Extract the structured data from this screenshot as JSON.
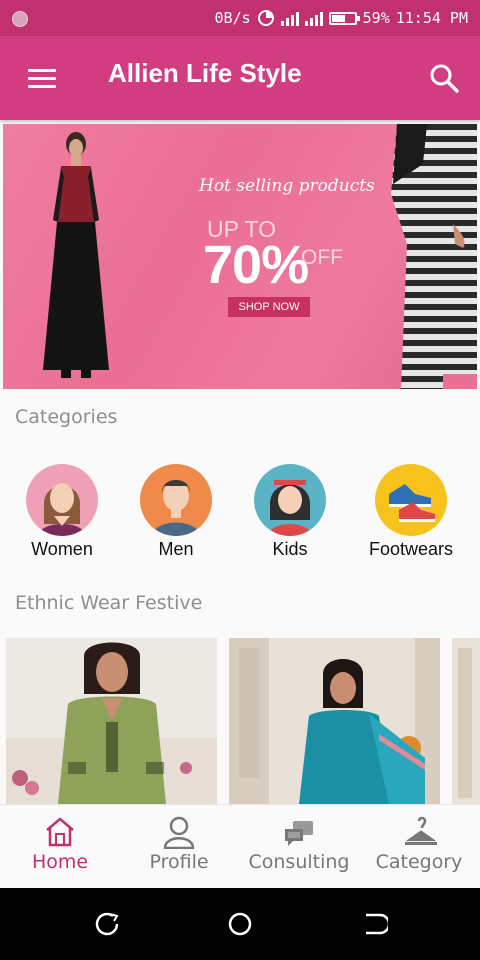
{
  "status_bar": {
    "net_speed": "0B/s",
    "battery_percent": "59%",
    "time": "11:54 PM"
  },
  "header": {
    "title": "Allien Life Style",
    "menu_icon": "menu-icon",
    "search_icon": "search-icon"
  },
  "banner": {
    "tagline": "Hot selling products",
    "up_to": "UP TO",
    "percent": "70%",
    "off": "OFF",
    "cta": "SHOP NOW"
  },
  "categories": {
    "heading": "Categories",
    "items": [
      {
        "label": "Women"
      },
      {
        "label": "Men"
      },
      {
        "label": "Kids"
      },
      {
        "label": "Footwears"
      }
    ]
  },
  "ethnic": {
    "heading": "Ethnic Wear Festive"
  },
  "bottom_nav": {
    "items": [
      {
        "label": "Home",
        "icon": "home-icon",
        "active": true
      },
      {
        "label": "Profile",
        "icon": "profile-icon",
        "active": false
      },
      {
        "label": "Consulting",
        "icon": "chat-icon",
        "active": false
      },
      {
        "label": "Category",
        "icon": "hanger-icon",
        "active": false
      }
    ]
  },
  "colors": {
    "primary": "#d23d82",
    "status_bar": "#c2306f",
    "banner_bg": "#ec6f95",
    "active_nav": "#c2306f"
  }
}
